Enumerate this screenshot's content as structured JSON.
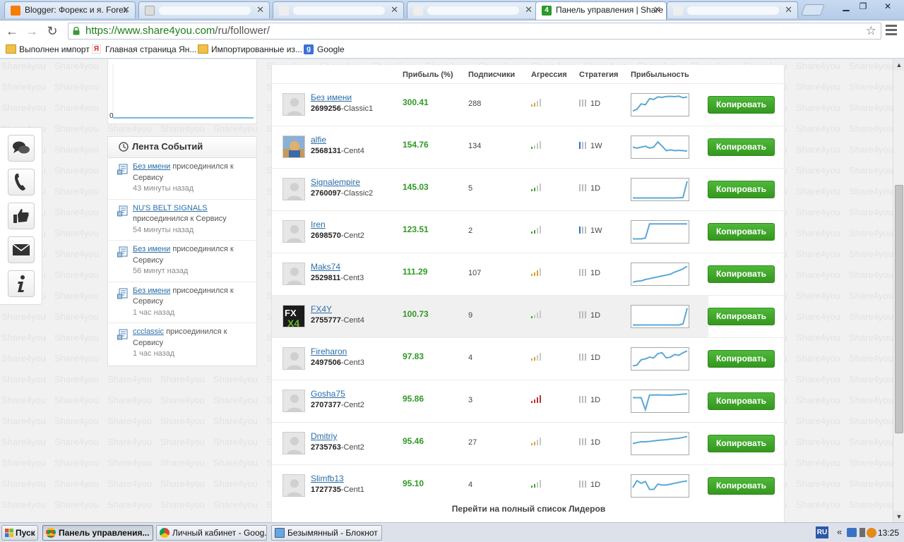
{
  "browser": {
    "tabs": [
      {
        "title": "Blogger: Форекс и я. Forex",
        "icon_color": "#f57d00",
        "active": false
      },
      {
        "title": "",
        "icon_color": "#cccccc",
        "active": false
      },
      {
        "title": "",
        "icon_color": "#cccccc",
        "active": false
      },
      {
        "title": "",
        "icon_color": "#cccccc",
        "active": false
      },
      {
        "title": "Панель управления | Share",
        "icon_color": "#2a9a2a",
        "active": true
      },
      {
        "title": "",
        "icon_color": "#cccccc",
        "active": false
      }
    ],
    "url_host": "https://www.share4you.com",
    "url_path": "/ru/follower/",
    "bookmarks": [
      {
        "label": "Выполнен импорт",
        "icon": "folder-icon"
      },
      {
        "label": "Главная страница Ян...",
        "icon": "yandex-icon"
      },
      {
        "label": "Импортированные из...",
        "icon": "folder-icon"
      },
      {
        "label": "Google",
        "icon": "google-icon"
      }
    ]
  },
  "chart": {
    "zero_label": "0"
  },
  "feed": {
    "title": "Лента Событий",
    "items": [
      {
        "user": "Без имени",
        "action": "присоединился к Сервису",
        "time": "43 минуты назад"
      },
      {
        "user": "NU'S BELT SIGNALS",
        "action": "присоединился к Сервису",
        "time": "54 минуты назад"
      },
      {
        "user": "Без имени",
        "action": "присоединился к Сервису",
        "time": "56 минут назад"
      },
      {
        "user": "Без имени",
        "action": "присоединился к Сервису",
        "time": "1 час назад"
      },
      {
        "user": "ccclassic",
        "action": "присоединился к Сервису",
        "time": "1 час назад"
      }
    ]
  },
  "leaders": {
    "headers": {
      "profit": "Прибыль (%)",
      "subscribers": "Подписчики",
      "aggression": "Агрессия",
      "strategy": "Стратегия",
      "profitability": "Прибыльность"
    },
    "copy_label": "Копировать",
    "full_list_label": "Перейти на полный список Лидеров",
    "colors": {
      "profit": "#2f9a24",
      "button": "#3aa526",
      "link": "#2a6ea8"
    },
    "rows": [
      {
        "name": "Без имени",
        "account": "2699256",
        "type": "-Classic1",
        "profit": "300.41",
        "subscribers": "288",
        "aggression": 2,
        "aggr_color": "#e0a020",
        "strategy": "1D",
        "strat_active": false,
        "avatar": "placeholder",
        "spark": [
          0.15,
          0.25,
          0.55,
          0.5,
          0.85,
          0.8,
          0.95,
          0.92,
          0.97,
          0.98,
          0.96,
          0.99,
          0.9,
          0.95
        ]
      },
      {
        "name": "alfie",
        "account": "2568131",
        "type": "-Cent4",
        "profit": "154.76",
        "subscribers": "134",
        "aggression": 1,
        "aggr_color": "#3aa526",
        "strategy": "1W",
        "strat_active": true,
        "avatar": "photo",
        "spark": [
          0.5,
          0.45,
          0.5,
          0.55,
          0.45,
          0.5,
          0.8,
          0.55,
          0.3,
          0.35,
          0.3,
          0.32,
          0.3,
          0.28
        ]
      },
      {
        "name": "Signalempire",
        "account": "2760097",
        "type": "-Classic2",
        "profit": "145.03",
        "subscribers": "5",
        "aggression": 2,
        "aggr_color": "#3aa526",
        "strategy": "1D",
        "strat_active": false,
        "avatar": "placeholder",
        "spark": [
          0.02,
          0.02,
          0.02,
          0.02,
          0.02,
          0.02,
          0.02,
          0.02,
          0.02,
          0.02,
          0.02,
          0.03,
          0.05,
          0.97
        ]
      },
      {
        "name": "Iren",
        "account": "2698570",
        "type": "-Cent2",
        "profit": "123.51",
        "subscribers": "2",
        "aggression": 2,
        "aggr_color": "#3aa526",
        "strategy": "1W",
        "strat_active": true,
        "avatar": "placeholder",
        "spark": [
          0.1,
          0.1,
          0.1,
          0.15,
          0.95,
          0.95,
          0.95,
          0.95,
          0.95,
          0.95,
          0.95,
          0.95,
          0.95,
          0.95
        ]
      },
      {
        "name": "Maks74",
        "account": "2529811",
        "type": "-Cent3",
        "profit": "111.29",
        "subscribers": "107",
        "aggression": 3,
        "aggr_color": "#e0a020",
        "strategy": "1D",
        "strat_active": false,
        "avatar": "placeholder",
        "spark": [
          0.05,
          0.1,
          0.12,
          0.2,
          0.25,
          0.3,
          0.35,
          0.4,
          0.45,
          0.5,
          0.62,
          0.7,
          0.8,
          0.95
        ]
      },
      {
        "name": "FX4Y",
        "account": "2755777",
        "type": "-Cent4",
        "profit": "100.73",
        "subscribers": "9",
        "aggression": 1,
        "aggr_color": "#3aa526",
        "strategy": "1D",
        "strat_active": false,
        "avatar": "logo",
        "highlight": true,
        "spark": [
          0.02,
          0.02,
          0.02,
          0.02,
          0.02,
          0.02,
          0.02,
          0.02,
          0.02,
          0.02,
          0.02,
          0.02,
          0.08,
          0.97
        ]
      },
      {
        "name": "Fireharon",
        "account": "2497506",
        "type": "-Cent3",
        "profit": "97.83",
        "subscribers": "4",
        "aggression": 2,
        "aggr_color": "#e0a020",
        "strategy": "1D",
        "strat_active": false,
        "avatar": "placeholder",
        "spark": [
          0.1,
          0.15,
          0.45,
          0.5,
          0.6,
          0.55,
          0.8,
          0.85,
          0.55,
          0.6,
          0.75,
          0.7,
          0.85,
          0.95
        ]
      },
      {
        "name": "Gosha75",
        "account": "2707377",
        "type": "-Cent2",
        "profit": "95.86",
        "subscribers": "3",
        "aggression": 4,
        "aggr_color": "#c03030",
        "strategy": "1D",
        "strat_active": false,
        "avatar": "placeholder",
        "spark": [
          0.7,
          0.7,
          0.7,
          0.02,
          0.85,
          0.85,
          0.86,
          0.85,
          0.85,
          0.84,
          0.86,
          0.88,
          0.9,
          0.92
        ]
      },
      {
        "name": "Dmitriy",
        "account": "2735763",
        "type": "-Cent2",
        "profit": "95.46",
        "subscribers": "27",
        "aggression": 2,
        "aggr_color": "#e0a020",
        "strategy": "1D",
        "strat_active": false,
        "avatar": "placeholder",
        "spark": [
          0.5,
          0.55,
          0.6,
          0.6,
          0.62,
          0.65,
          0.68,
          0.7,
          0.72,
          0.75,
          0.78,
          0.8,
          0.85,
          0.9
        ]
      },
      {
        "name": "Slimfb13",
        "account": "1727735",
        "type": "-Cent1",
        "profit": "95.10",
        "subscribers": "4",
        "aggression": 2,
        "aggr_color": "#3aa526",
        "strategy": "1D",
        "strat_active": false,
        "avatar": "placeholder",
        "spark": [
          0.4,
          0.8,
          0.65,
          0.75,
          0.3,
          0.3,
          0.6,
          0.55,
          0.55,
          0.6,
          0.65,
          0.7,
          0.75,
          0.78
        ]
      }
    ]
  },
  "taskbar": {
    "start_label": "Пуск",
    "tasks": [
      {
        "label": "Панель управления...",
        "active": true
      },
      {
        "label": "Личный кабинет - Goog...",
        "active": false
      },
      {
        "label": "Безымянный - Блокнот",
        "active": false
      }
    ],
    "lang": "RU",
    "clock": "13:25"
  }
}
